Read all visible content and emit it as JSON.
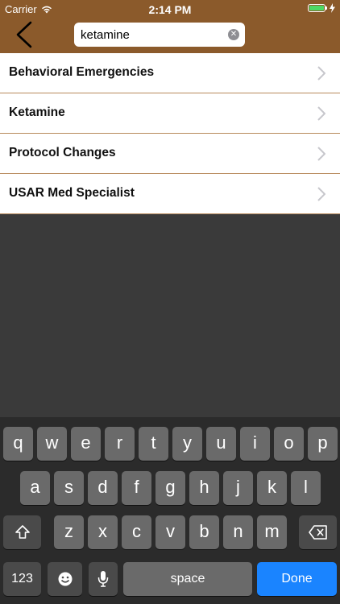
{
  "status_bar": {
    "carrier": "Carrier",
    "time": "2:14 PM"
  },
  "search": {
    "value": "ketamine"
  },
  "results": [
    {
      "label": "Behavioral Emergencies"
    },
    {
      "label": "Ketamine"
    },
    {
      "label": "Protocol Changes"
    },
    {
      "label": "USAR Med Specialist"
    }
  ],
  "keyboard": {
    "row1": [
      "q",
      "w",
      "e",
      "r",
      "t",
      "y",
      "u",
      "i",
      "o",
      "p"
    ],
    "row2": [
      "a",
      "s",
      "d",
      "f",
      "g",
      "h",
      "j",
      "k",
      "l"
    ],
    "row3": [
      "z",
      "x",
      "c",
      "v",
      "b",
      "n",
      "m"
    ],
    "numbers_label": "123",
    "space_label": "space",
    "done_label": "Done"
  },
  "colors": {
    "header": "#8b5a2b",
    "done": "#1a84ff",
    "battery": "#4cd964"
  }
}
